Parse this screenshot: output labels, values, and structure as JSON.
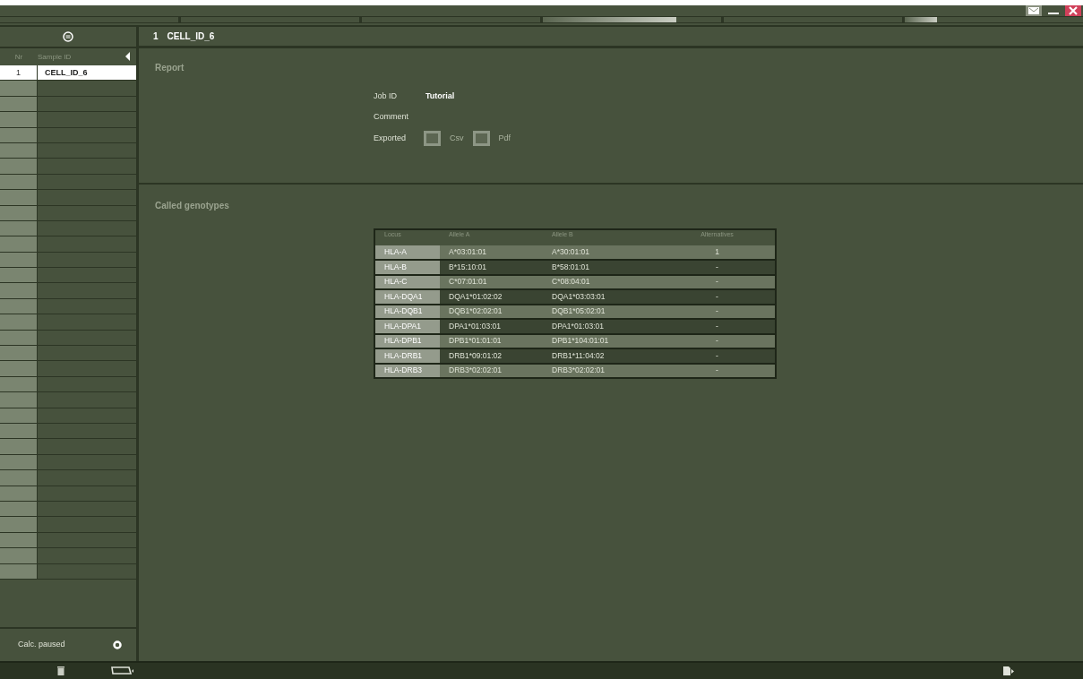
{
  "progress_segments": [
    {
      "kind": "empty"
    },
    {
      "kind": "empty"
    },
    {
      "kind": "empty"
    },
    {
      "kind": "progress",
      "level": 0.75
    },
    {
      "kind": "empty"
    },
    {
      "kind": "progress",
      "level": 0.18
    }
  ],
  "sidebar": {
    "columns": [
      "Nr",
      "Sample ID"
    ],
    "rows": [
      {
        "nr": "1",
        "sample_id": "CELL_ID_6",
        "selected": true
      }
    ],
    "status": "Calc. paused"
  },
  "header": {
    "nr": "1",
    "sample_id": "CELL_ID_6"
  },
  "report": {
    "title": "Report",
    "fields": [
      {
        "label": "Job ID",
        "value": "Tutorial"
      },
      {
        "label": "Comment"
      }
    ],
    "exported": {
      "label": "Exported",
      "options": [
        {
          "label": "Csv",
          "checked": false,
          "disabled": true
        },
        {
          "label": "Pdf",
          "checked": false,
          "disabled": true
        }
      ]
    }
  },
  "genotypes": {
    "title": "Called genotypes",
    "columns": [
      "Locus",
      "Allele A",
      "Allele B",
      "Alternatives"
    ],
    "rows": [
      [
        "HLA-A",
        "A*03:01:01",
        "A*30:01:01",
        "1"
      ],
      [
        "HLA-B",
        "B*15:10:01",
        "B*58:01:01",
        "-"
      ],
      [
        "HLA-C",
        "C*07:01:01",
        "C*08:04:01",
        "-"
      ],
      [
        "HLA-DQA1",
        "DQA1*01:02:02",
        "DQA1*03:03:01",
        "-"
      ],
      [
        "HLA-DQB1",
        "DQB1*02:02:01",
        "DQB1*05:02:01",
        "-"
      ],
      [
        "HLA-DPA1",
        "DPA1*01:03:01",
        "DPA1*01:03:01",
        "-"
      ],
      [
        "HLA-DPB1",
        "DPB1*01:01:01",
        "DPB1*104:01:01",
        "-"
      ],
      [
        "HLA-DRB1",
        "DRB1*09:01:02",
        "DRB1*11:04:02",
        "-"
      ],
      [
        "HLA-DRB3",
        "DRB3*02:02:01",
        "DRB3*02:02:01",
        "-"
      ]
    ]
  }
}
